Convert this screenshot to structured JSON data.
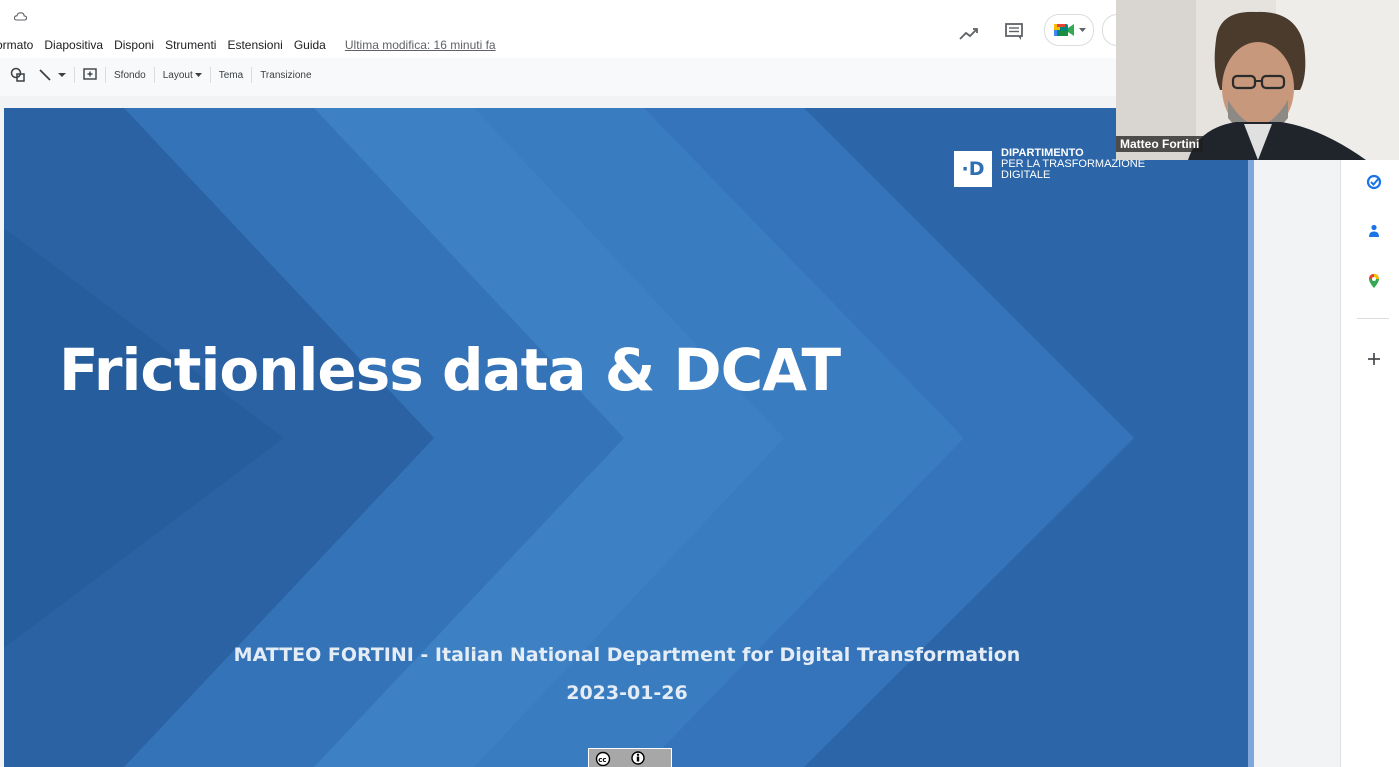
{
  "menu": {
    "items": [
      "ormato",
      "Diapositiva",
      "Disponi",
      "Strumenti",
      "Estensioni",
      "Guida"
    ],
    "last_edit": "Ultima modifica: 16 minuti fa"
  },
  "toolbar": {
    "background_label": "Sfondo",
    "layout_label": "Layout",
    "theme_label": "Tema",
    "transition_label": "Transizione"
  },
  "slide": {
    "title": "Frictionless data & DCAT",
    "author": "MATTEO FORTINI - Italian National Department for Digital Transformation",
    "date": "2023-01-26",
    "logo_letter": "·D",
    "logo_line1": "DIPARTIMENTO",
    "logo_line2": "PER LA TRASFORMAZIONE",
    "logo_line3": "DIGITALE",
    "license_badge": "cc-by-icon"
  },
  "video": {
    "participant_name": "Matteo Fortini"
  },
  "side_panel": {
    "icons": [
      "tasks-icon",
      "contacts-icon",
      "maps-icon",
      "add-icon"
    ]
  },
  "colors": {
    "slide_blue": "#2f6fb2",
    "tasks_blue": "#1a73e8",
    "meet_green": "#00897b"
  }
}
